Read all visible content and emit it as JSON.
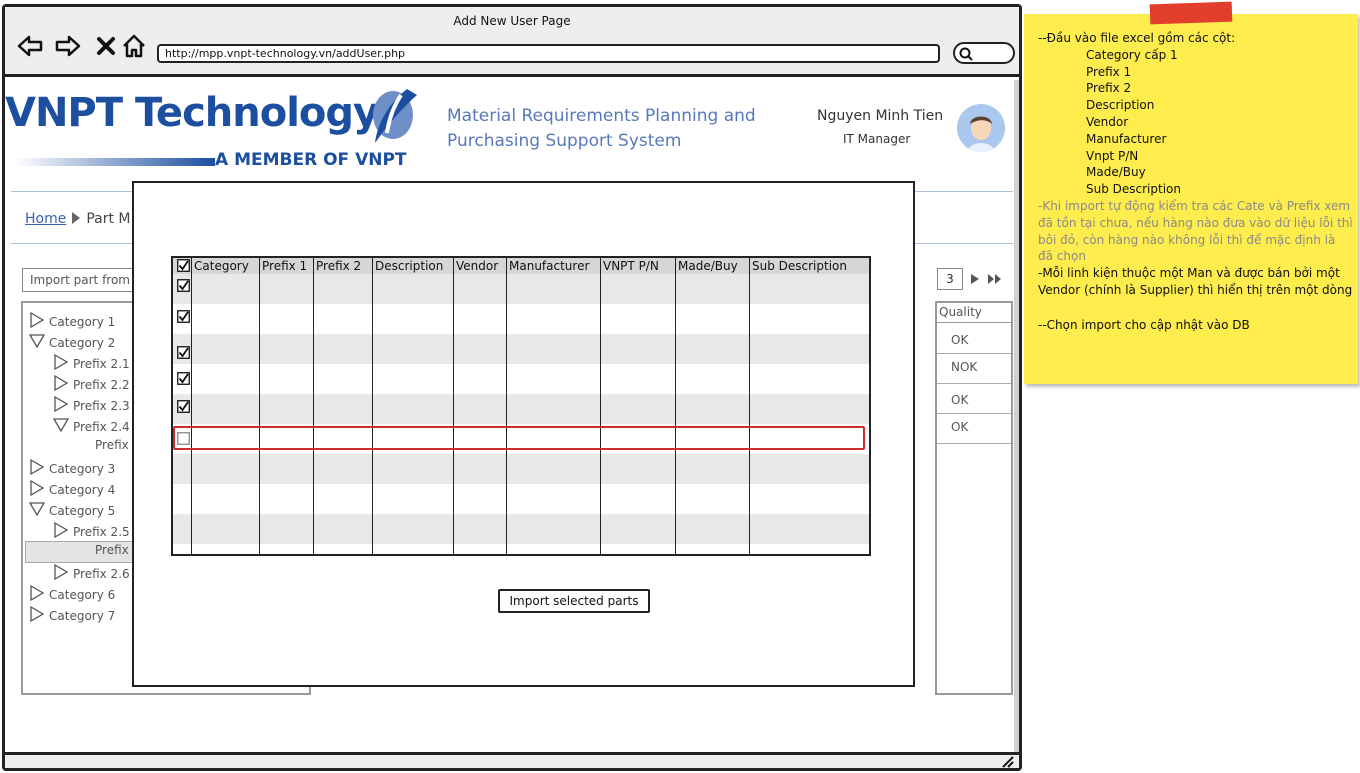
{
  "browser": {
    "title": "Add New User Page",
    "url": "http://mpp.vnpt-technology.vn/addUser.php"
  },
  "header": {
    "logo_text": "VNPT Technology",
    "logo_tagline": "A MEMBER OF VNPT",
    "system_title": "Material Requirements Planning and Purchasing Support System",
    "user_name": "Nguyen Minh Tien",
    "user_role": "IT Manager"
  },
  "breadcrumb": {
    "home": "Home",
    "current": "Part M"
  },
  "import_input": {
    "placeholder": "Import part from e"
  },
  "pager": {
    "page": "3"
  },
  "tree": {
    "items": [
      {
        "label": "Category 1",
        "state": "collapsed"
      },
      {
        "label": "Category 2",
        "state": "expanded"
      },
      {
        "label": "Prefix 2.1",
        "state": "collapsed"
      },
      {
        "label": "Prefix 2.2",
        "state": "collapsed"
      },
      {
        "label": "Prefix 2.3",
        "state": "collapsed"
      },
      {
        "label": "Prefix 2.4",
        "state": "expanded"
      },
      {
        "label": "Prefix",
        "state": "leaf"
      },
      {
        "label": "Category 3",
        "state": "collapsed"
      },
      {
        "label": "Category 4",
        "state": "collapsed"
      },
      {
        "label": "Category 5",
        "state": "expanded"
      },
      {
        "label": "Prefix 2.5",
        "state": "collapsed"
      },
      {
        "label": "Prefix",
        "state": "leaf",
        "selected": true
      },
      {
        "label": "Prefix 2.6",
        "state": "collapsed"
      },
      {
        "label": "Category 6",
        "state": "collapsed"
      },
      {
        "label": "Category 7",
        "state": "collapsed"
      }
    ]
  },
  "quality": {
    "header": "Quality",
    "values": [
      "OK",
      "NOK",
      "OK",
      "OK"
    ]
  },
  "modal": {
    "columns": [
      "Category",
      "Prefix 1",
      "Prefix 2",
      "Description",
      "Vendor",
      "Manufacturer",
      "VNPT P/N",
      "Made/Buy",
      "Sub Description"
    ],
    "header_checked": true,
    "rows_checked": [
      true,
      true,
      true,
      true,
      true,
      false
    ],
    "import_button": "Import selected parts"
  },
  "note": {
    "intro": "--Đầu vào file excel gồm các cột:",
    "columns": [
      "Category cấp 1",
      "Prefix 1",
      "Prefix 2",
      "Description",
      "Vendor",
      "Manufacturer",
      "Vnpt P/N",
      "Made/Buy",
      "Sub Description"
    ],
    "bullet": "",
    "auto_check": "-Khi import tự động kiểm tra các Cate và Prefix xem đã tồn tại chưa, nếu hàng nào đưa vào dữ liệu lỗi thì bôi đỏ, còn hàng nào không lỗi thì để mặc định là đã chọn",
    "vendor_rule": "-Mỗi linh kiện thuộc một Man và được bán bởi một Vendor (chính là Supplier) thì hiển thị trên một dòng",
    "import_note": "--Chọn import cho cập nhật vào DB"
  },
  "colors": {
    "brand": "#1c4fa0",
    "subtitle": "#5879b8",
    "note_bg": "#ffec4d",
    "tape": "#e23e2c",
    "error_row": "#d02a2a"
  }
}
